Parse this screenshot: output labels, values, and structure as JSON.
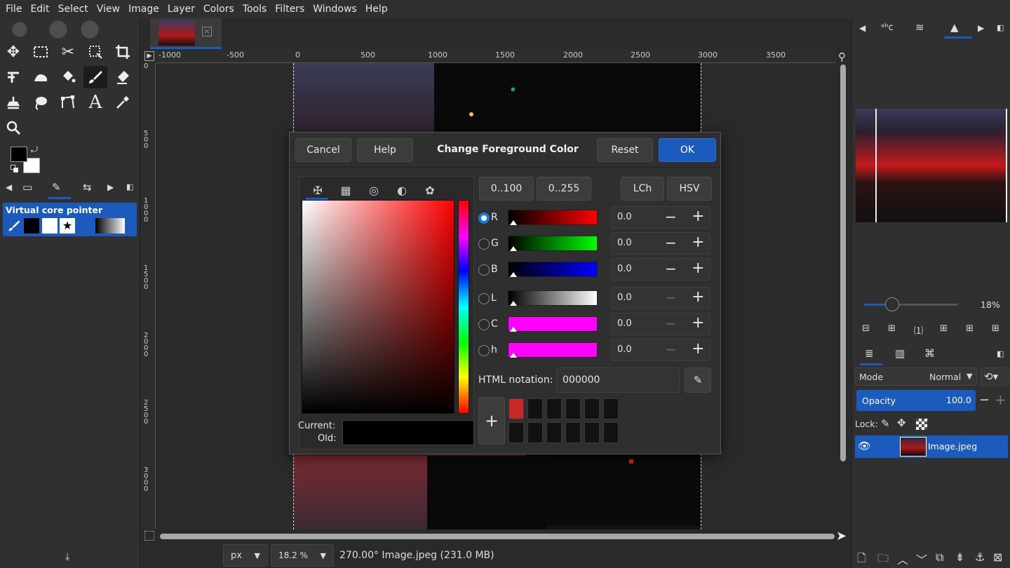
{
  "menubar": [
    "File",
    "Edit",
    "Select",
    "View",
    "Image",
    "Layer",
    "Colors",
    "Tools",
    "Filters",
    "Windows",
    "Help"
  ],
  "toolbox": {
    "tools": [
      "move-icon",
      "rect-select-icon",
      "scissors-icon",
      "fuzzy-select-icon",
      "crop-icon",
      "warp-icon",
      "smudge-icon",
      "bucket-fill-icon",
      "paintbrush-icon",
      "eraser-icon",
      "clone-icon",
      "lasso-icon",
      "path-icon",
      "text-icon",
      "color-picker-icon",
      "zoom-icon"
    ],
    "device_panel": {
      "title": "Virtual core pointer"
    }
  },
  "ruler": {
    "h_labels": [
      "-1000",
      "-500",
      "0",
      "500",
      "1000",
      "1500",
      "2000",
      "2500",
      "3000",
      "3500"
    ],
    "v_labels": [
      "0",
      "5\n0\n0",
      "1\n0\n0\n0",
      "1\n5\n0\n0",
      "2\n0\n0\n0",
      "2\n5\n0\n0",
      "3\n0\n0\n0"
    ]
  },
  "status": {
    "unit": "px",
    "zoom": "18.2 %",
    "info": "270.00° Image.jpeg (231.0 MB)"
  },
  "dialog": {
    "title": "Change Foreground Color",
    "cancel": "Cancel",
    "help": "Help",
    "reset": "Reset",
    "ok": "OK",
    "range_100": "0..100",
    "range_255": "0..255",
    "lch": "LCh",
    "hsv": "HSV",
    "channels": [
      {
        "label": "R",
        "value": "0.0",
        "selected": true
      },
      {
        "label": "G",
        "value": "0.0",
        "selected": false
      },
      {
        "label": "B",
        "value": "0.0",
        "selected": false
      },
      {
        "label": "L",
        "value": "0.0",
        "selected": false
      },
      {
        "label": "C",
        "value": "0.0",
        "selected": false
      },
      {
        "label": "h",
        "value": "0.0",
        "selected": false
      }
    ],
    "html_notation_label": "HTML notation:",
    "html_notation_value": "000000",
    "current_label": "Current:",
    "old_label": "Old:",
    "history_colors": [
      "#c62828",
      "#111111",
      "#111111",
      "#111111",
      "#111111",
      "#111111",
      "#111111",
      "#111111",
      "#111111",
      "#111111",
      "#111111",
      "#111111"
    ],
    "current_color": "#000000",
    "old_color": "#000000"
  },
  "navigator": {
    "zoom": "18%",
    "zoom_fraction": 0.3
  },
  "layers": {
    "mode_label": "Mode",
    "mode_value": "Normal",
    "opacity_label": "Opacity",
    "opacity_value": "100.0",
    "lock_label": "Lock:",
    "layer_name": "Image.jpeg"
  },
  "colors": {
    "accent": "#1b5bbd",
    "fg": "#000000",
    "bg": "#ffffff"
  }
}
